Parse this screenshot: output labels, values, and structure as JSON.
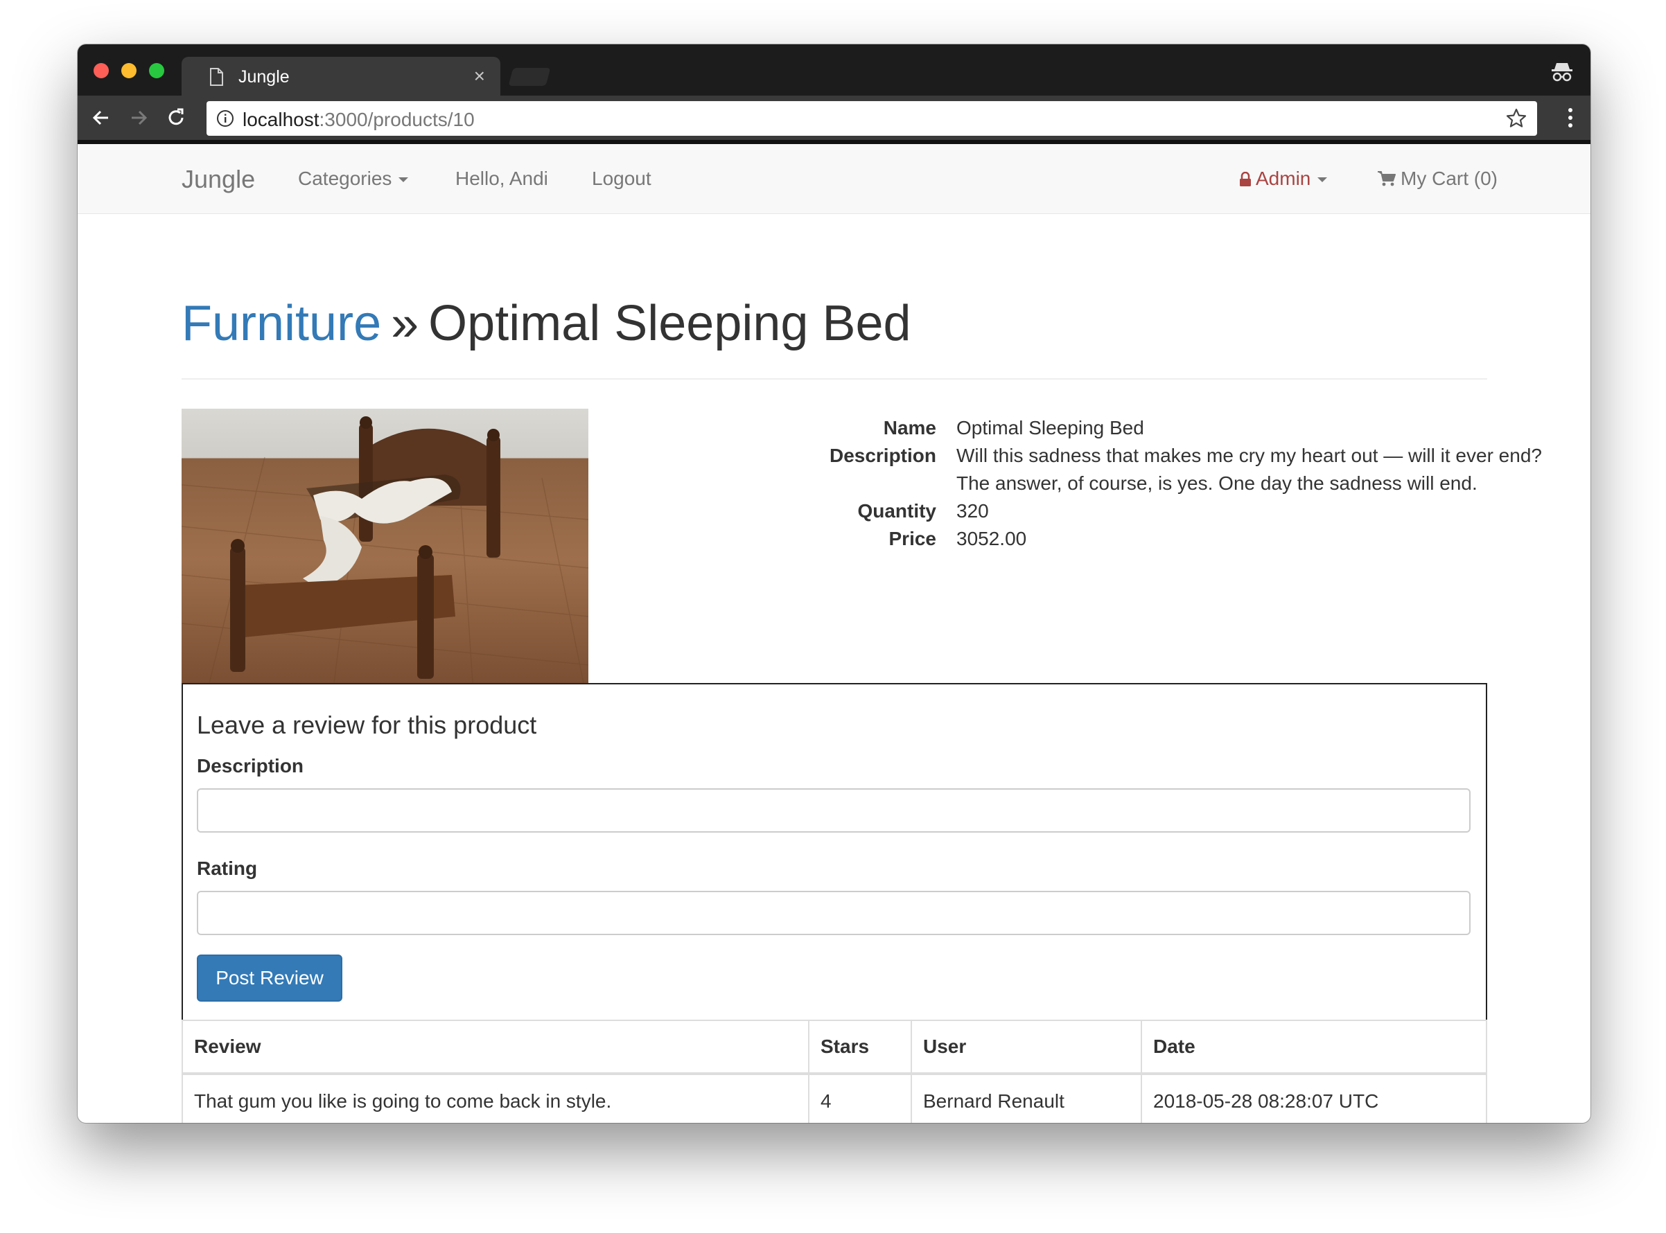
{
  "browser": {
    "tab_title": "Jungle",
    "tab_close": "×",
    "url_host": "localhost",
    "url_rest": ":3000/products/10"
  },
  "navbar": {
    "brand": "Jungle",
    "categories": "Categories",
    "greeting": "Hello, Andi",
    "logout": "Logout",
    "admin": "Admin",
    "cart": "My Cart (0)"
  },
  "product": {
    "category": "Furniture",
    "separator": "»",
    "title": "Optimal Sleeping Bed",
    "labels": {
      "name": "Name",
      "description": "Description",
      "quantity": "Quantity",
      "price": "Price"
    },
    "name": "Optimal Sleeping Bed",
    "description_line1": "Will this sadness that makes me cry my heart out — will it ever end?",
    "description_line2": "The answer, of course, is yes. One day the sadness will end.",
    "quantity": "320",
    "price": "3052.00"
  },
  "review_form": {
    "heading": "Leave a review for this product",
    "description_label": "Description",
    "description_value": "",
    "rating_label": "Rating",
    "rating_value": "",
    "submit": "Post Review"
  },
  "reviews_table": {
    "headers": [
      "Review",
      "Stars",
      "User",
      "Date"
    ],
    "rows": [
      {
        "review": "That gum you like is going to come back in style.",
        "stars": "4",
        "user": "Bernard Renault",
        "date": "2018-05-28 08:28:07 UTC"
      }
    ]
  },
  "colors": {
    "link_blue": "#337ab7",
    "admin_red": "#a94442",
    "navbar_bg": "#f8f8f8",
    "chrome_dark": "#1c1c1c"
  }
}
